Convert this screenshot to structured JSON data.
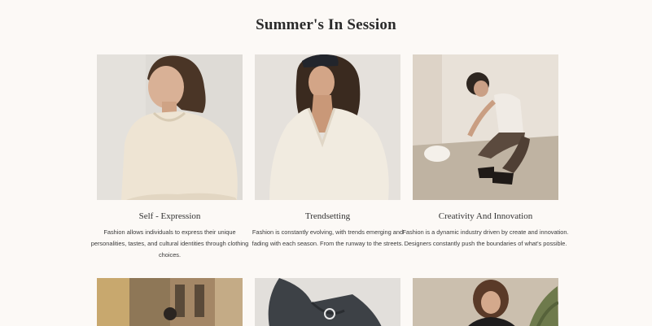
{
  "section": {
    "title": "Summer's In Session"
  },
  "cards": [
    {
      "title": "Self - Expression",
      "description": "Fashion allows individuals to express their unique personalities, tastes, and cultural identities through clothing choices.",
      "image_icon": "woman-knit-sweater-photo"
    },
    {
      "title": "Trendsetting",
      "description": "Fashion is constantly evolving, with trends emerging and fading with each season. From the runway to the streets.",
      "image_icon": "woman-cap-vneck-sweater-photo"
    },
    {
      "title": "Creativity And Innovation",
      "description": "Fashion is a dynamic industry driven by create and innovation. Designers constantly push the boundaries of what's possible.",
      "image_icon": "woman-crouching-hat-photo"
    }
  ],
  "row2": [
    {
      "image_icon": "street-scene-photo"
    },
    {
      "image_icon": "man-jacket-photo"
    },
    {
      "image_icon": "woman-plant-photo"
    }
  ],
  "colors": {
    "background": "#fcf9f6",
    "text": "#2b2b2b"
  }
}
